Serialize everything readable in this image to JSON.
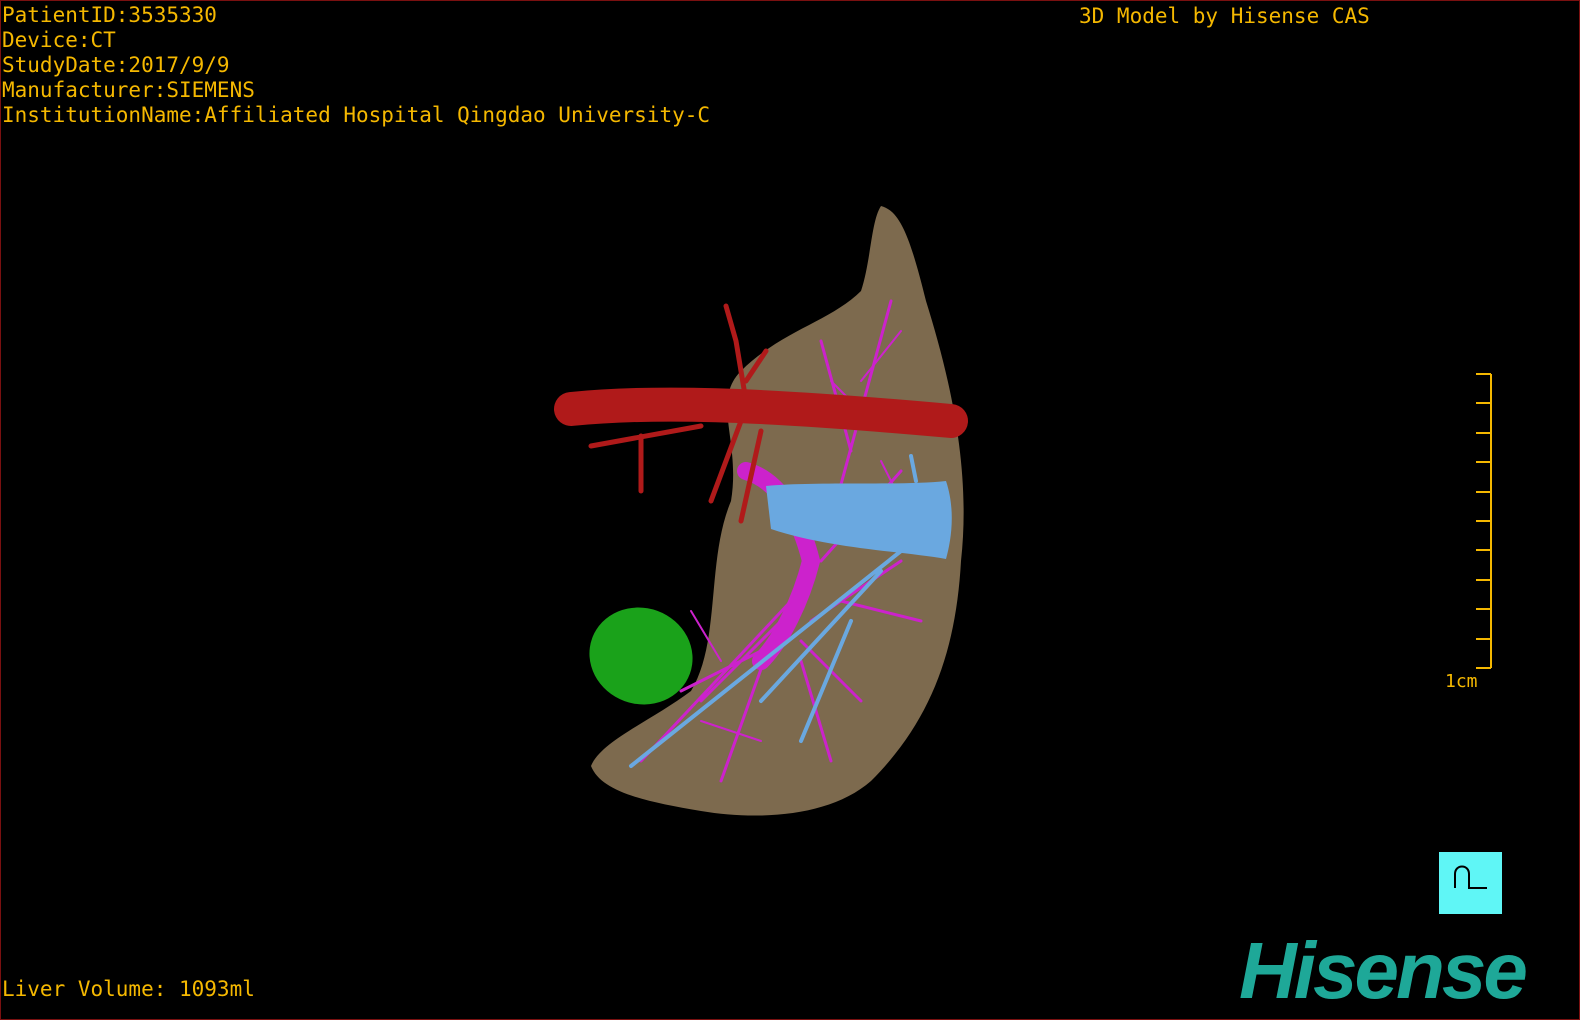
{
  "patient_info": {
    "patient_id": "PatientID:3535330",
    "device": "Device:CT",
    "study_date": "StudyDate:2017/9/9",
    "manufacturer": "Manufacturer:SIEMENS",
    "institution": "InstitutionName:Affiliated Hospital Qingdao University-C"
  },
  "brand_caption": "3D Model by Hisense CAS",
  "liver_volume": "Liver Volume: 1093ml",
  "scale_bar": {
    "label": "1cm"
  },
  "orientation_cube": {
    "label": "P",
    "color": "#5ff6f6"
  },
  "logo": "Hisense",
  "colors": {
    "text": "#f5b800",
    "liver": "#7d6a4e",
    "artery": "#b01a1a",
    "portal_vein": "#cc22cc",
    "hepatic_vein": "#6aa8e0",
    "lesion": "#1aa21a",
    "logo": "#1ea898"
  }
}
